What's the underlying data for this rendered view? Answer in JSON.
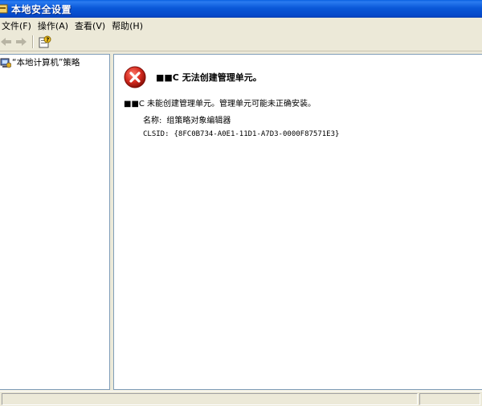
{
  "window": {
    "title": "本地安全设置"
  },
  "menu": [
    {
      "label": "文件(F)"
    },
    {
      "label": "操作(A)"
    },
    {
      "label": "查看(V)"
    },
    {
      "label": "帮助(H)"
    }
  ],
  "toolbar": {
    "buttons": [
      "back-arrow-icon",
      "forward-arrow-icon",
      "help-properties-icon"
    ]
  },
  "tree": {
    "root": {
      "label": "“本地计算机”策略",
      "icon": "policy-computer-icon"
    }
  },
  "error": {
    "icon": "error-icon",
    "title": "■■C 无法创建管理单元。",
    "message": "■■C 未能创建管理单元。管理单元可能未正确安装。",
    "name_label": "名称:",
    "name_value": "组策略对象编辑器",
    "clsid_label": "CLSID:",
    "clsid_value": "{8FC0B734-A0E1-11D1-A7D3-0000F87571E3}"
  },
  "colors": {
    "titlebar": "#0a58d8",
    "error_red": "#d42a1f",
    "chrome": "#ece9d8"
  }
}
